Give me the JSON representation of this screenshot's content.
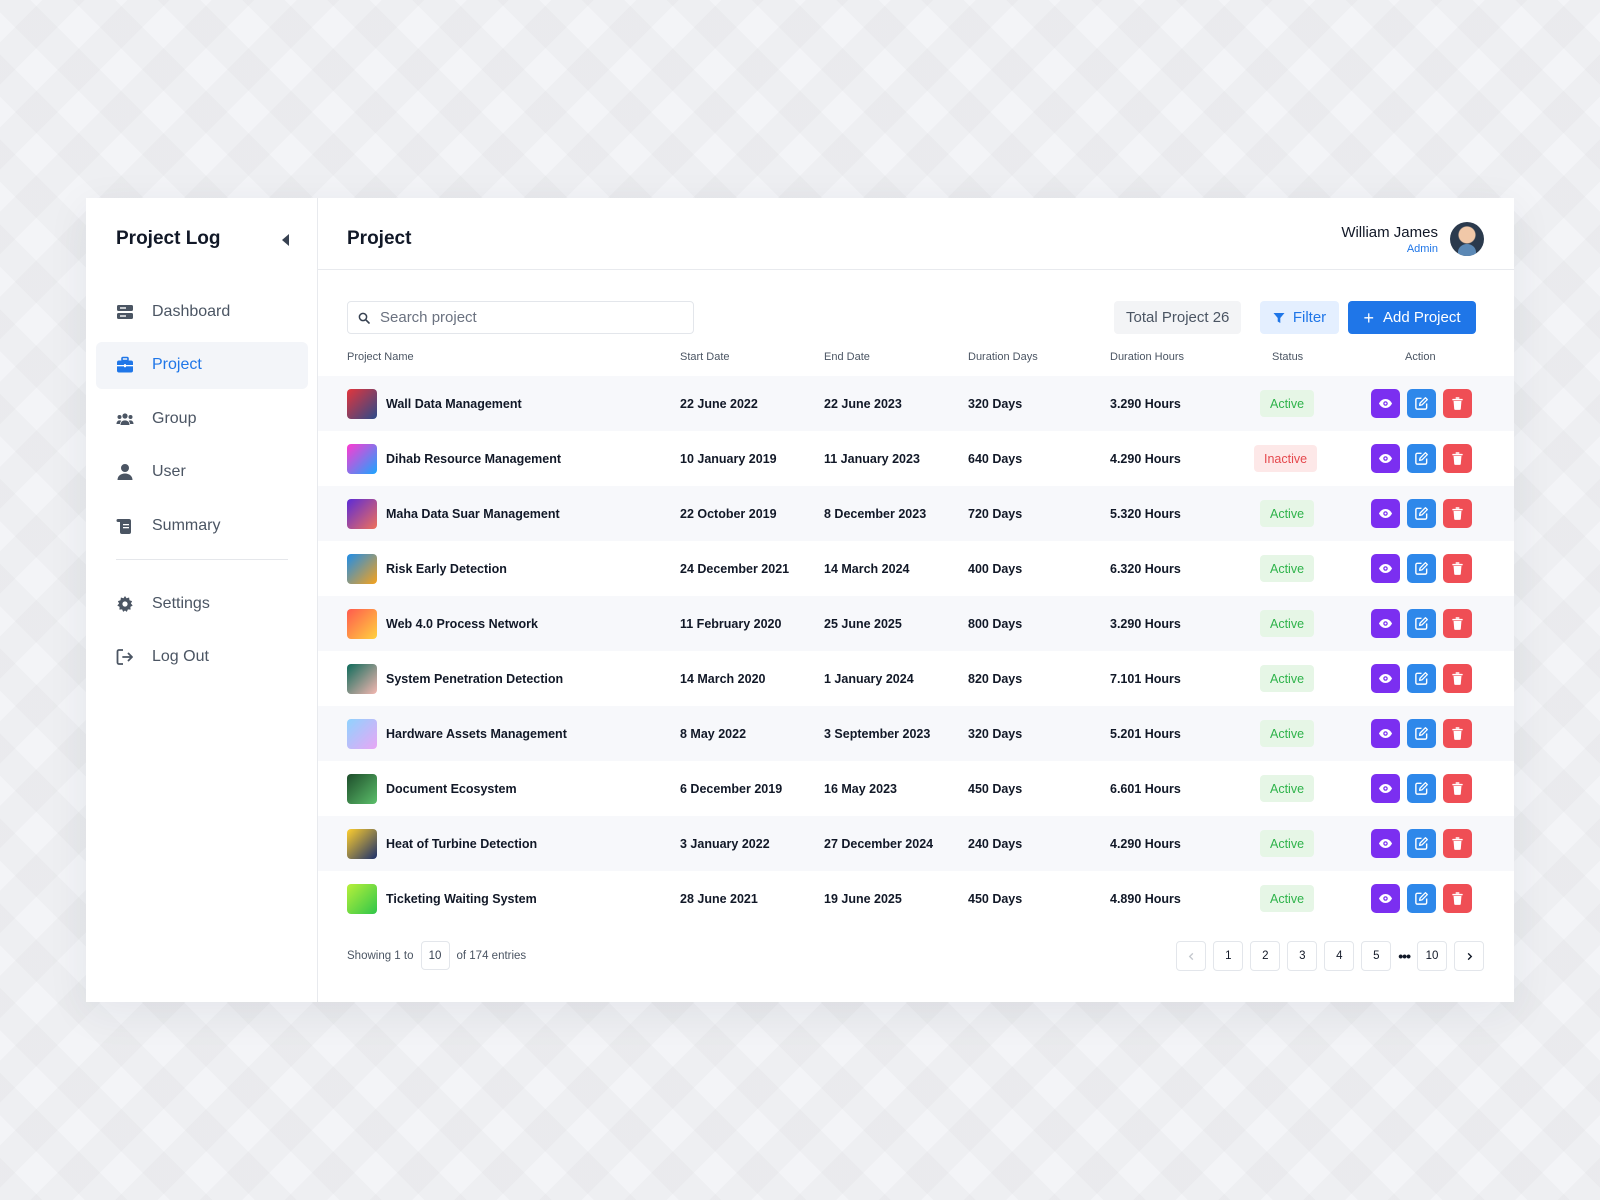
{
  "sidebar": {
    "brand": "Project Log",
    "nav": [
      {
        "label": "Dashboard",
        "icon": "dashboard-icon"
      },
      {
        "label": "Project",
        "icon": "briefcase-icon",
        "active": true
      },
      {
        "label": "Group",
        "icon": "group-icon"
      },
      {
        "label": "User",
        "icon": "user-icon"
      },
      {
        "label": "Summary",
        "icon": "summary-icon"
      }
    ],
    "nav_bottom": [
      {
        "label": "Settings",
        "icon": "gear-icon"
      },
      {
        "label": "Log Out",
        "icon": "logout-icon"
      }
    ]
  },
  "header": {
    "title": "Project",
    "user_name": "William James",
    "user_role": "Admin"
  },
  "toolbar": {
    "search_placeholder": "Search project",
    "total_label": "Total Project 26",
    "filter_label": "Filter",
    "add_label": "Add Project"
  },
  "table": {
    "columns": [
      "Project Name",
      "Start Date",
      "End Date",
      "Duration Days",
      "Duration Hours",
      "Status",
      "Action"
    ],
    "rows": [
      {
        "name": "Wall Data Management",
        "start": "22 June 2022",
        "end": "22 June 2023",
        "days": "320 Days",
        "hours": "3.290 Hours",
        "status": "Active"
      },
      {
        "name": "Dihab Resource Management",
        "start": "10 January 2019",
        "end": "11 January 2023",
        "days": "640 Days",
        "hours": "4.290 Hours",
        "status": "Inactive"
      },
      {
        "name": "Maha Data Suar Management",
        "start": "22 October 2019",
        "end": "8 December 2023",
        "days": "720 Days",
        "hours": "5.320 Hours",
        "status": "Active"
      },
      {
        "name": "Risk Early Detection",
        "start": "24 December 2021",
        "end": "14 March 2024",
        "days": "400 Days",
        "hours": "6.320 Hours",
        "status": "Active"
      },
      {
        "name": "Web 4.0 Process Network",
        "start": "11 February 2020",
        "end": "25 June 2025",
        "days": "800 Days",
        "hours": "3.290 Hours",
        "status": "Active"
      },
      {
        "name": "System Penetration Detection",
        "start": "14 March 2020",
        "end": "1 January 2024",
        "days": "820 Days",
        "hours": "7.101 Hours",
        "status": "Active"
      },
      {
        "name": "Hardware Assets Management",
        "start": "8 May 2022",
        "end": "3 September 2023",
        "days": "320 Days",
        "hours": "5.201 Hours",
        "status": "Active"
      },
      {
        "name": "Document Ecosystem",
        "start": "6 December 2019",
        "end": "16 May 2023",
        "days": "450 Days",
        "hours": "6.601 Hours",
        "status": "Active"
      },
      {
        "name": "Heat of Turbine Detection",
        "start": "3 January 2022",
        "end": "27 December 2024",
        "days": "240 Days",
        "hours": "4.290 Hours",
        "status": "Active"
      },
      {
        "name": "Ticketing Waiting System",
        "start": "28 June 2021",
        "end": "19 June 2025",
        "days": "450 Days",
        "hours": "4.890 Hours",
        "status": "Active"
      }
    ],
    "thumb_colors": [
      [
        "#e4353b",
        "#2a4a8a"
      ],
      [
        "#ff3ad1",
        "#1aa6ff"
      ],
      [
        "#5b2bd6",
        "#f0705a"
      ],
      [
        "#1f8de8",
        "#f7a21b"
      ],
      [
        "#ff5a4e",
        "#ffd23f"
      ],
      [
        "#0f6b5b",
        "#f5b7b1"
      ],
      [
        "#8fd3fe",
        "#e9a6f5"
      ],
      [
        "#1e4d2b",
        "#5bbf6a"
      ],
      [
        "#ffcf2e",
        "#1b2f6b"
      ],
      [
        "#b8f03a",
        "#2fc64a"
      ]
    ]
  },
  "footer": {
    "showing_prefix": "Showing 1 to",
    "page_size": "10",
    "showing_suffix": "of 174 entries",
    "pages": [
      "1",
      "2",
      "3",
      "4",
      "5"
    ],
    "last_page": "10",
    "ellipsis": "•••"
  }
}
